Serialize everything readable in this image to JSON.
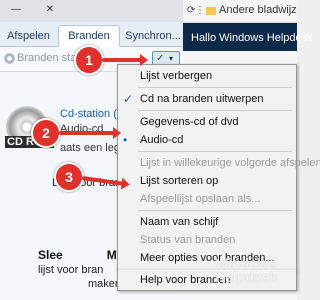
{
  "window": {
    "minimize_glyph": "—",
    "close_glyph": "✕"
  },
  "tabs": [
    "Afspelen",
    "Branden",
    "Synchron..."
  ],
  "burn_bar": {
    "start_label": "Branden starte",
    "options_glyph": "✓",
    "dropdown_glyph": "▾"
  },
  "disc": {
    "label": "CD ROM",
    "drive": "Cd-station (E:)",
    "type": "Audio-cd",
    "free_space": "aats een lege",
    "list_hint": "Lijst voor brande"
  },
  "sleep_panel": {
    "title": "Slee",
    "title_rest": "Merk",
    "line1": "lijst voor bran",
    "line2": "maken."
  },
  "browser": {
    "bookmark_label": "Andere bladwijz",
    "header_text": "Hallo Windows Helpdesk",
    "nav_icons": [
      "⟳",
      "⋮"
    ]
  },
  "menu": {
    "items": [
      {
        "label": "Lijst verbergen",
        "mark": "",
        "enabled": true
      },
      {
        "label": "Cd na branden uitwerpen",
        "mark": "✓",
        "enabled": true
      },
      {
        "label": "Gegevens-cd of dvd",
        "mark": "",
        "enabled": true
      },
      {
        "label": "Audio-cd",
        "mark": "•",
        "enabled": true
      },
      {
        "label": "Lijst in willekeurige volgorde afspelen",
        "mark": "",
        "enabled": false
      },
      {
        "label": "Lijst sorteren op",
        "mark": "",
        "enabled": true
      },
      {
        "label": "Afspeellijst opslaan als...",
        "mark": "",
        "enabled": false
      },
      {
        "label": "Naam van schijf",
        "mark": "",
        "enabled": true
      },
      {
        "label": "Status van branden",
        "mark": "",
        "enabled": false
      },
      {
        "label": "Meer opties voor branden...",
        "mark": "",
        "enabled": true
      },
      {
        "label": "Help voor branden",
        "mark": "",
        "enabled": true
      }
    ]
  },
  "callouts": [
    "1",
    "2",
    "3"
  ],
  "watermark": {
    "line1": "Windows",
    "line2": "Helpdesk"
  },
  "colors": {
    "callout": "#e0312b",
    "accent": "#1c5fa8",
    "header_dark": "#0d2a4a"
  }
}
